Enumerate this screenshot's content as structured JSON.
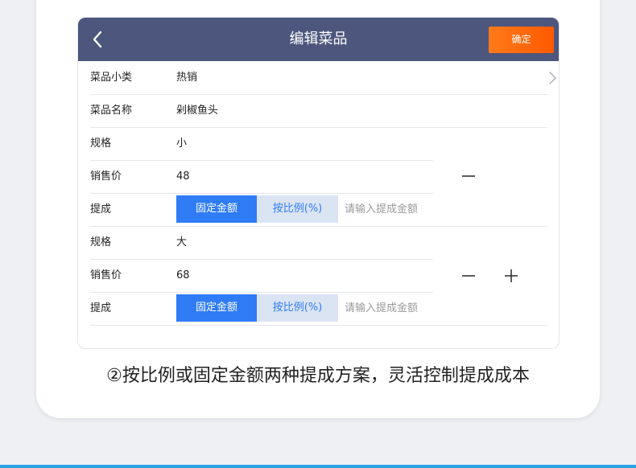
{
  "header": {
    "title": "编辑菜品",
    "confirm_label": "确定",
    "back_icon": "chevron-left-icon"
  },
  "fields": {
    "category": {
      "label": "菜品小类",
      "value": "热销"
    },
    "name": {
      "label": "菜品名称",
      "value": "剁椒鱼头"
    }
  },
  "specs": [
    {
      "spec_label": "规格",
      "spec_value": "小",
      "price_label": "销售价",
      "price_value": "48",
      "commission_label": "提成",
      "fixed_label": "固定金额",
      "ratio_label": "按比例(%)",
      "amount_placeholder": "请输入提成金额"
    },
    {
      "spec_label": "规格",
      "spec_value": "大",
      "price_label": "销售价",
      "price_value": "68",
      "commission_label": "提成",
      "fixed_label": "固定金额",
      "ratio_label": "按比例(%)",
      "amount_placeholder": "请输入提成金额"
    }
  ],
  "caption": "②按比例或固定金额两种提成方案，灵活控制提成成本",
  "colors": {
    "topbar": "#4d577d",
    "confirm": "#ff6a0a",
    "primary": "#2f7cf6",
    "ratio_bg": "#dbe4f3"
  }
}
